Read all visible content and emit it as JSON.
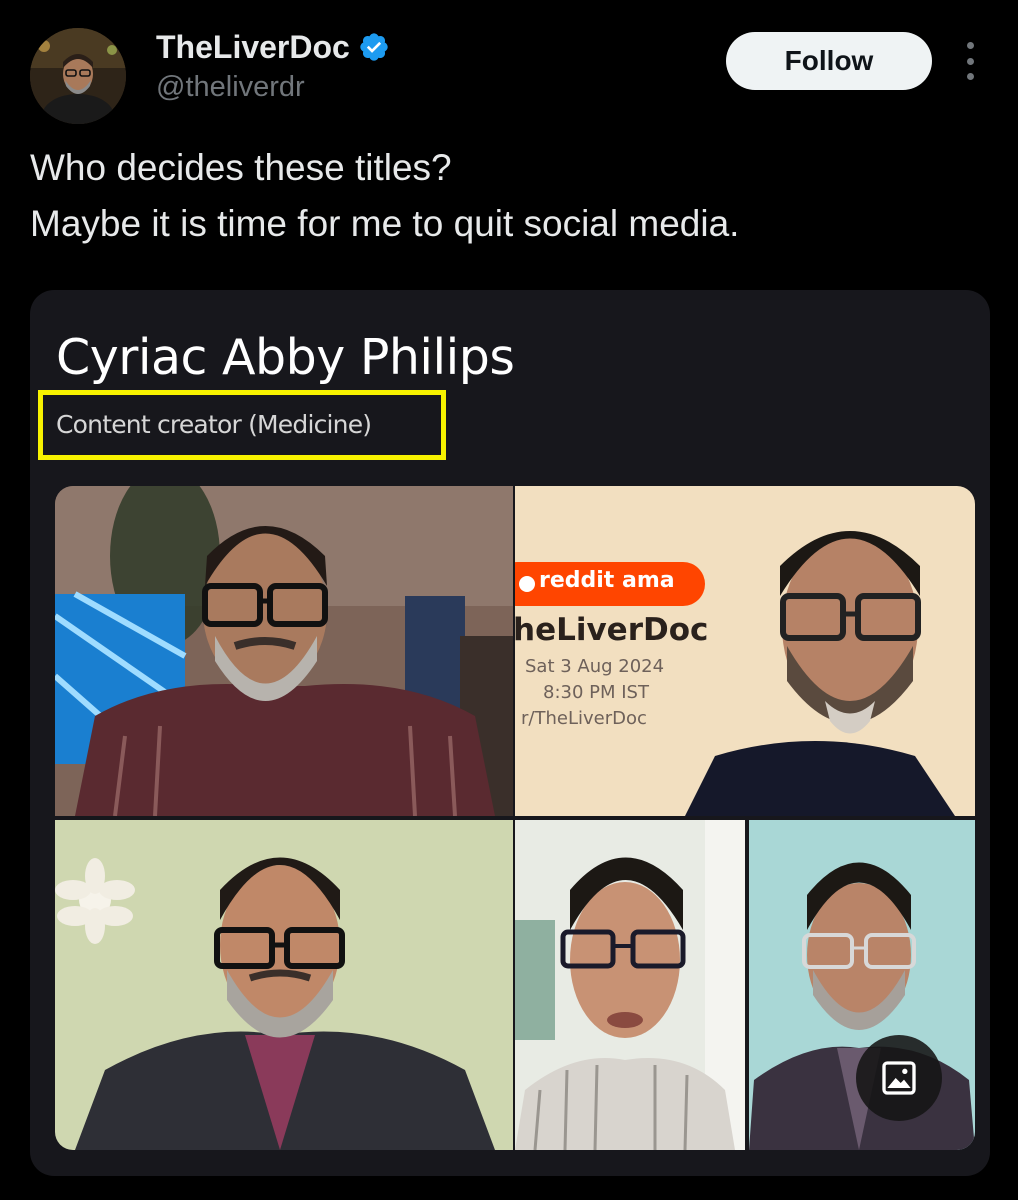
{
  "author": {
    "display_name": "TheLiverDoc",
    "handle": "@theliverdr",
    "verified": true,
    "verified_color": "#1d9bf0"
  },
  "actions": {
    "follow_label": "Follow"
  },
  "tweet": {
    "lines": [
      "Who decides these titles?",
      "Maybe it is time for me to quit social media."
    ]
  },
  "media": {
    "title": "Cyriac Abby Philips",
    "subtitle": "Content creator (Medicine)",
    "highlight_color": "#f7f200",
    "ama_card": {
      "brand": "reddit ama",
      "name": "heLiverDoc",
      "date": "Sat 3 Aug 2024",
      "time": "8:30 PM IST",
      "subreddit": "r/TheLiverDoc"
    },
    "badge_icon": "image-icon"
  },
  "colors": {
    "background": "#000000",
    "card_background": "#17171c",
    "text_primary": "#e7e9ea",
    "text_secondary": "#71767b",
    "reddit_orange": "#ff4500"
  }
}
